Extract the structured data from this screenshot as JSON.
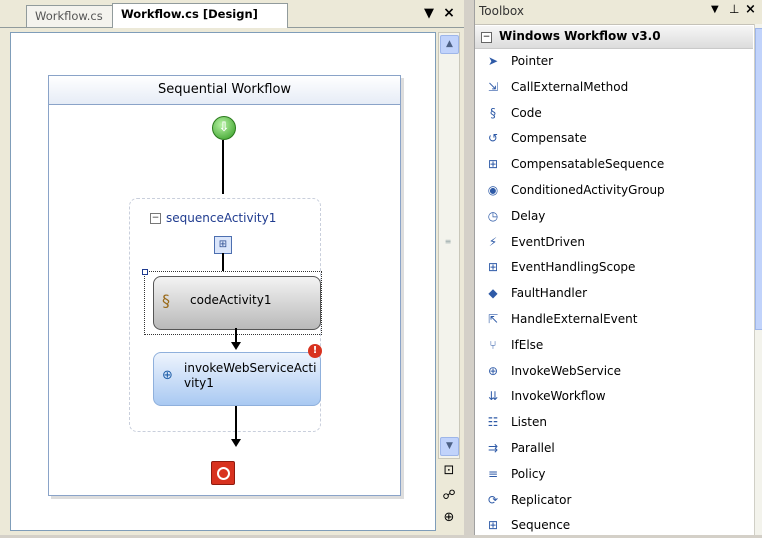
{
  "tabs": {
    "code_tab": "Workflow.cs",
    "design_tab": "Workflow.cs [Design]",
    "menu_glyph": "▼",
    "close_glyph": "×"
  },
  "workflow": {
    "title": "Sequential Workflow",
    "sequence_label": "sequenceActivity1",
    "code_activity_label": "codeActivity1",
    "invoke_activity_label": "invokeWebServiceActivity1"
  },
  "toolbox": {
    "title": "Toolbox",
    "section": "Windows Workflow v3.0",
    "items": [
      {
        "label": "Pointer",
        "icon": "pointer-icon",
        "glyph": "➤"
      },
      {
        "label": "CallExternalMethod",
        "icon": "call-external-method-icon",
        "glyph": "⇲"
      },
      {
        "label": "Code",
        "icon": "code-icon",
        "glyph": "§"
      },
      {
        "label": "Compensate",
        "icon": "compensate-icon",
        "glyph": "↺"
      },
      {
        "label": "CompensatableSequence",
        "icon": "compensatable-sequence-icon",
        "glyph": "⊞"
      },
      {
        "label": "ConditionedActivityGroup",
        "icon": "conditioned-activity-group-icon",
        "glyph": "◉"
      },
      {
        "label": "Delay",
        "icon": "delay-icon",
        "glyph": "◷"
      },
      {
        "label": "EventDriven",
        "icon": "event-driven-icon",
        "glyph": "⚡"
      },
      {
        "label": "EventHandlingScope",
        "icon": "event-handling-scope-icon",
        "glyph": "⊞"
      },
      {
        "label": "FaultHandler",
        "icon": "fault-handler-icon",
        "glyph": "◆"
      },
      {
        "label": "HandleExternalEvent",
        "icon": "handle-external-event-icon",
        "glyph": "⇱"
      },
      {
        "label": "IfElse",
        "icon": "if-else-icon",
        "glyph": "⑂"
      },
      {
        "label": "InvokeWebService",
        "icon": "invoke-web-service-icon",
        "glyph": "⊕"
      },
      {
        "label": "InvokeWorkflow",
        "icon": "invoke-workflow-icon",
        "glyph": "⇊"
      },
      {
        "label": "Listen",
        "icon": "listen-icon",
        "glyph": "☷"
      },
      {
        "label": "Parallel",
        "icon": "parallel-icon",
        "glyph": "⇉"
      },
      {
        "label": "Policy",
        "icon": "policy-icon",
        "glyph": "≡"
      },
      {
        "label": "Replicator",
        "icon": "replicator-icon",
        "glyph": "⟳"
      },
      {
        "label": "Sequence",
        "icon": "sequence-icon",
        "glyph": "⊞"
      }
    ]
  },
  "colors": {
    "accent": "#1f3b8f",
    "error": "#d8321f",
    "start": "#2f9a1f"
  }
}
